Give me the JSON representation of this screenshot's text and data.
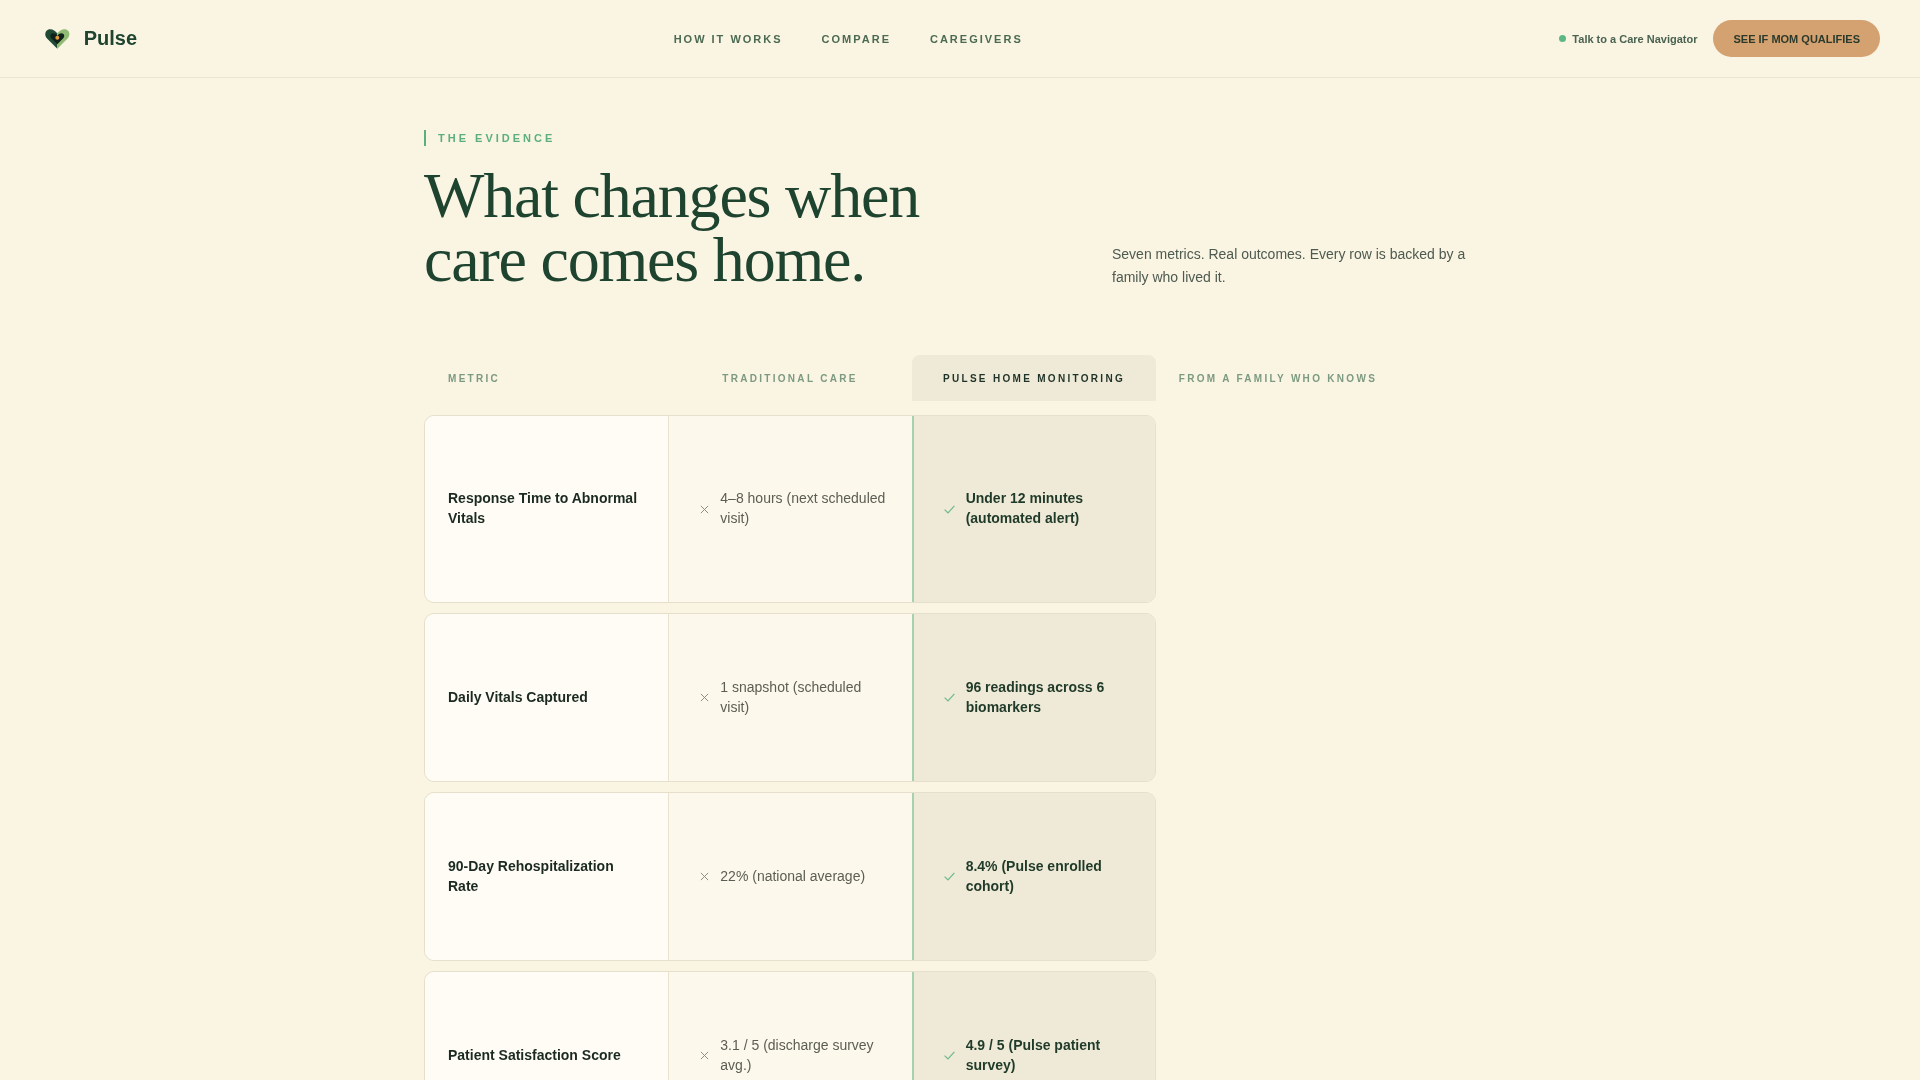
{
  "header": {
    "brand": "Pulse",
    "nav": [
      {
        "label": "HOW IT WORKS"
      },
      {
        "label": "COMPARE"
      },
      {
        "label": "CAREGIVERS"
      }
    ],
    "contact_link": "Talk to a Care Navigator",
    "cta_button": "SEE IF MOM QUALIFIES"
  },
  "intro": {
    "eyebrow": "THE EVIDENCE",
    "heading_lines": [
      "What changes when",
      "care comes home."
    ],
    "description": "Seven metrics. Real outcomes. Every row is backed by a family who lived it."
  },
  "comparison": {
    "columns": [
      {
        "label": "METRIC",
        "kind": "label",
        "highlighted": false
      },
      {
        "label": "TRADITIONAL CARE",
        "kind": "negative",
        "highlighted": false
      },
      {
        "label": "PULSE HOME MONITORING",
        "kind": "positive",
        "highlighted": true
      },
      {
        "label": "FROM A FAMILY WHO KNOWS",
        "kind": "quote",
        "highlighted": false
      }
    ],
    "rows": [
      {
        "cells": [
          "Response Time to Abnormal Vitals",
          "4–8 hours (next scheduled visit)",
          "Under 12 minutes (automated alert)"
        ]
      },
      {
        "cells": [
          "Daily Vitals Captured",
          "1 snapshot (scheduled visit)",
          "96 readings across 6 biomarkers"
        ]
      },
      {
        "cells": [
          "90-Day Rehospitalization Rate",
          "22% (national average)",
          "8.4% (Pulse enrolled cohort)"
        ]
      },
      {
        "cells": [
          "Patient Satisfaction Score",
          "3.1 / 5 (discharge survey avg.)",
          "4.9 / 5 (Pulse patient survey)"
        ]
      }
    ]
  }
}
